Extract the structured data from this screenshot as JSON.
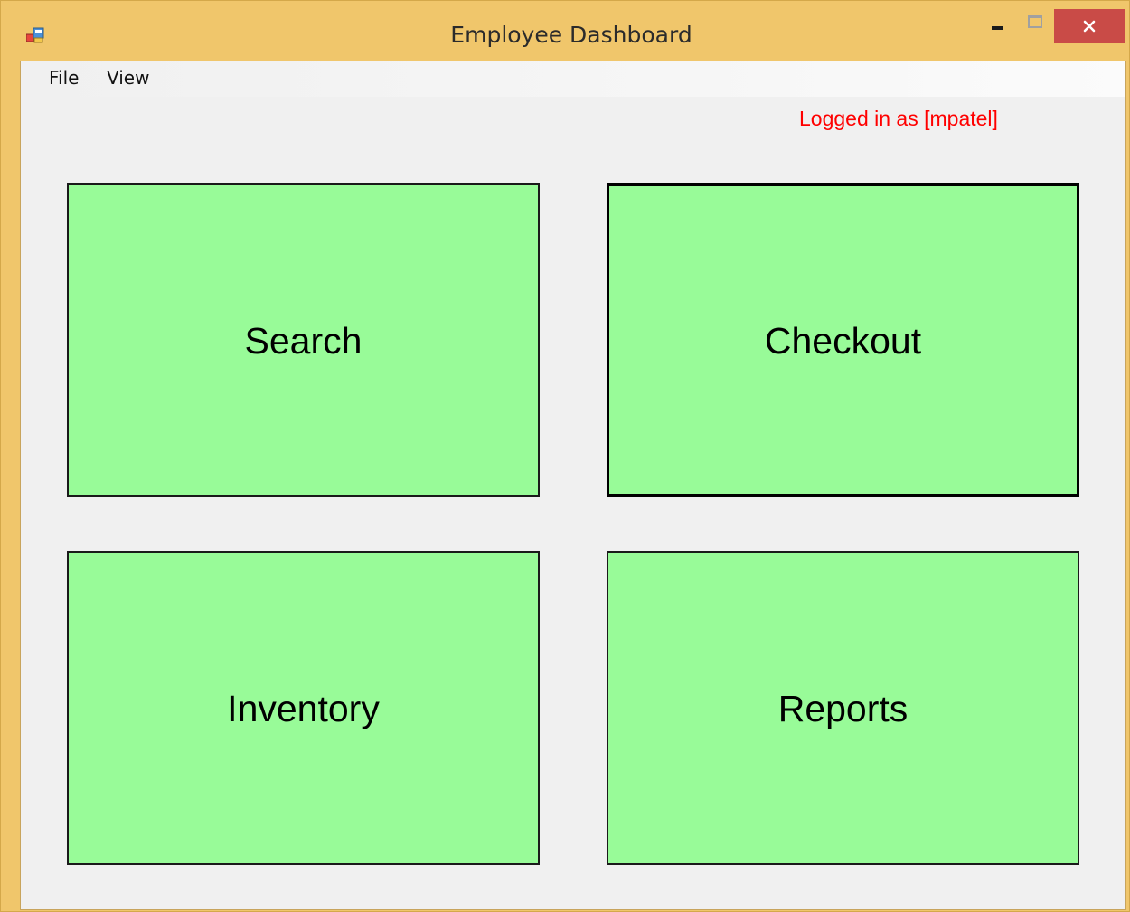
{
  "window": {
    "title": "Employee Dashboard",
    "app_icon": "winforms-app-icon",
    "controls": {
      "minimize_icon": "minimize-icon",
      "maximize_icon": "maximize-icon",
      "close_glyph": "✕"
    },
    "frame_color": "#f0c66b",
    "close_color": "#c94b47"
  },
  "menu": {
    "items": [
      {
        "label": "File"
      },
      {
        "label": "View"
      }
    ]
  },
  "status": {
    "login_text": "Logged in as [mpatel]",
    "color": "#ff0000"
  },
  "tiles": [
    {
      "label": "Search",
      "focused": false
    },
    {
      "label": "Checkout",
      "focused": true
    },
    {
      "label": "Inventory",
      "focused": false
    },
    {
      "label": "Reports",
      "focused": false
    }
  ],
  "colors": {
    "tile_background": "#98fb98",
    "client_background": "#f0f0f0"
  }
}
